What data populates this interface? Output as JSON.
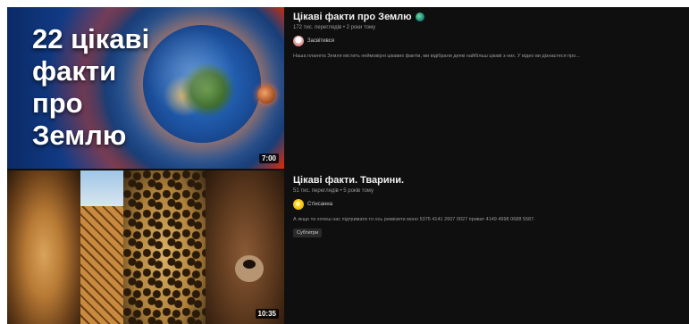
{
  "videos": [
    {
      "thumbnail_text": "22 цікаві факти про Землю",
      "duration": "7:00",
      "title": "Цікаві факти про Землю",
      "stats": "172 тис. переглядів • 2 роки тому",
      "channel": "Засвітився",
      "description": "Наша планета Земля містить неймовірні цікавих фактів, ми відібрали деякі найбільш цікаві з них. У відео ви дізнаєтеся про...",
      "icons": [
        "globe-icon"
      ]
    },
    {
      "duration": "10:35",
      "title": "Цікаві факти. Тварини.",
      "stats": "51 тис. переглядів • 5 років тому",
      "channel": "Стінсанна",
      "description": "А якщо ти хочеш нас підтримати то ось реквізити моно 5375 4141 2607 0027 приват 4149 4998 0688 5587.",
      "chip": "Субтитри"
    }
  ]
}
